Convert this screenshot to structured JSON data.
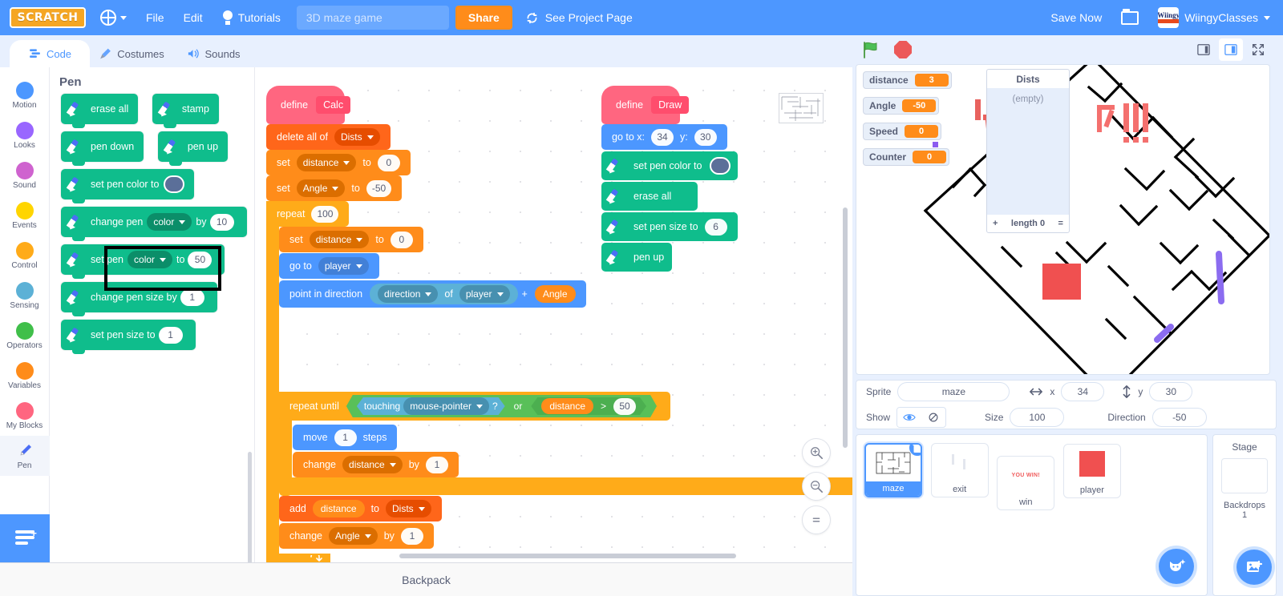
{
  "menubar": {
    "logo": "SCRATCH",
    "language_icon": "globe-icon",
    "file": "File",
    "edit": "Edit",
    "tutorials": "Tutorials",
    "tutorials_icon": "lightbulb-icon",
    "project_title": "3D maze game",
    "project_title_placeholder": "Project title",
    "share": "Share",
    "see_project_page": "See Project Page",
    "save_now": "Save Now",
    "folder_icon": "folder-icon",
    "username": "WiingyClasses",
    "avatar_top": "Wiingy"
  },
  "tabs": [
    {
      "label": "Code",
      "icon": "code-icon",
      "active": true
    },
    {
      "label": "Costumes",
      "icon": "paintbrush-icon",
      "active": false
    },
    {
      "label": "Sounds",
      "icon": "speaker-icon",
      "active": false
    }
  ],
  "categories": [
    {
      "label": "Motion",
      "color": "#4c97ff",
      "selected": false
    },
    {
      "label": "Looks",
      "color": "#9966ff",
      "selected": false
    },
    {
      "label": "Sound",
      "color": "#cf63cf",
      "selected": false
    },
    {
      "label": "Events",
      "color": "#ffd500",
      "selected": false
    },
    {
      "label": "Control",
      "color": "#ffab19",
      "selected": false
    },
    {
      "label": "Sensing",
      "color": "#5cb1d6",
      "selected": false
    },
    {
      "label": "Operators",
      "color": "#40bf4a",
      "selected": false
    },
    {
      "label": "Variables",
      "color": "#ff8c1a",
      "selected": false
    },
    {
      "label": "My Blocks",
      "color": "#ff6680",
      "selected": false
    },
    {
      "label": "Pen",
      "color": "#0fbd8c",
      "selected": true
    }
  ],
  "palette": {
    "header": "Pen",
    "blocks": [
      {
        "id": "erase-all",
        "text": "erase all",
        "parts": []
      },
      {
        "id": "stamp",
        "text": "stamp",
        "parts": []
      },
      {
        "id": "pen-down",
        "text": "pen down",
        "parts": []
      },
      {
        "id": "pen-up",
        "text": "pen up",
        "parts": [],
        "highlighted": true
      },
      {
        "id": "set-pen-color",
        "text": "set pen color to",
        "swatch": "#5b6f99"
      },
      {
        "id": "change-pen-by",
        "pre": "change pen",
        "dropdown": "color",
        "mid": "by",
        "value": "10"
      },
      {
        "id": "set-pen-to",
        "pre": "set pen",
        "dropdown": "color",
        "mid": "to",
        "value": "50"
      },
      {
        "id": "change-pen-size",
        "pre": "change pen size by",
        "value": "1"
      },
      {
        "id": "set-pen-size",
        "pre": "set pen size to",
        "value": "1"
      }
    ]
  },
  "scripts": {
    "calc": {
      "define": "define",
      "name": "Calc",
      "delete_all_of": "delete all of",
      "dists": "Dists",
      "set": "set",
      "to": "to",
      "distance": "distance",
      "zero": "0",
      "angle": "Angle",
      "minus50": "-50",
      "repeat": "repeat",
      "repeat_count": "100",
      "go_to": "go to",
      "player": "player",
      "point_in_direction": "point in direction",
      "direction": "direction",
      "of": "of",
      "plus": "+",
      "repeat_until": "repeat until",
      "touching": "touching",
      "mouse_pointer": "mouse-pointer",
      "question": "?",
      "or": "or",
      "gt": ">",
      "fifty": "50",
      "move": "move",
      "one": "1",
      "steps": "steps",
      "change": "change",
      "by": "by",
      "add": "add"
    },
    "draw": {
      "define": "define",
      "name": "Draw",
      "go_to_x": "go to x:",
      "x_val": "34",
      "y_label": "y:",
      "y_val": "30",
      "set_pen_color_to": "set pen color to",
      "pen_color": "#5b6f99",
      "erase_all": "erase all",
      "set_pen_size_to": "set pen size to",
      "pen_size": "6",
      "pen_up": "pen up"
    }
  },
  "workspace": {
    "zoom_in": "zoom-in",
    "zoom_out": "zoom-out",
    "zoom_reset": "zoom-reset",
    "backpack": "Backpack"
  },
  "stage": {
    "green_flag": "green-flag",
    "stop": "stop-sign",
    "size_controls": [
      "small-stage",
      "large-stage",
      "fullscreen"
    ],
    "monitors": [
      {
        "name": "distance",
        "value": "3"
      },
      {
        "name": "Angle",
        "value": "-50"
      },
      {
        "name": "Speed",
        "value": "0"
      },
      {
        "name": "Counter",
        "value": "0"
      }
    ],
    "list_monitor": {
      "title": "Dists",
      "empty_text": "(empty)",
      "add": "+",
      "length_label": "length 0",
      "resize": "="
    }
  },
  "sprite_info": {
    "sprite_label": "Sprite",
    "sprite_name": "maze",
    "x_label": "x",
    "x_value": "34",
    "y_label": "y",
    "y_value": "30",
    "show_label": "Show",
    "show_on_icon": "eye-icon",
    "show_off_icon": "eye-slash-icon",
    "size_label": "Size",
    "size_value": "100",
    "direction_label": "Direction",
    "direction_value": "-50"
  },
  "sprites": [
    {
      "name": "maze",
      "selected": true,
      "thumb": "maze-thumb"
    },
    {
      "name": "exit",
      "selected": false,
      "thumb": "exit-thumb"
    },
    {
      "name": "win",
      "selected": false,
      "thumb": "win-thumb",
      "thumb_text": "YOU WIN!"
    },
    {
      "name": "player",
      "selected": false,
      "thumb": "player-thumb"
    }
  ],
  "stage_pane": {
    "title": "Stage",
    "backdrops_label": "Backdrops",
    "backdrop_count": "1",
    "add_sprite_icon": "add-sprite-icon",
    "add_backdrop_icon": "add-backdrop-icon"
  },
  "colors": {
    "menubar": "#4d97ff",
    "pen": "#0fbd8c",
    "motion": "#4c97ff",
    "control": "#ffab19",
    "variables": "#ff8c1a",
    "list": "#ff661a",
    "myblocks": "#ff6680",
    "operators": "#59c059",
    "sensing": "#5cb1d6",
    "share": "#ff8c1a"
  }
}
